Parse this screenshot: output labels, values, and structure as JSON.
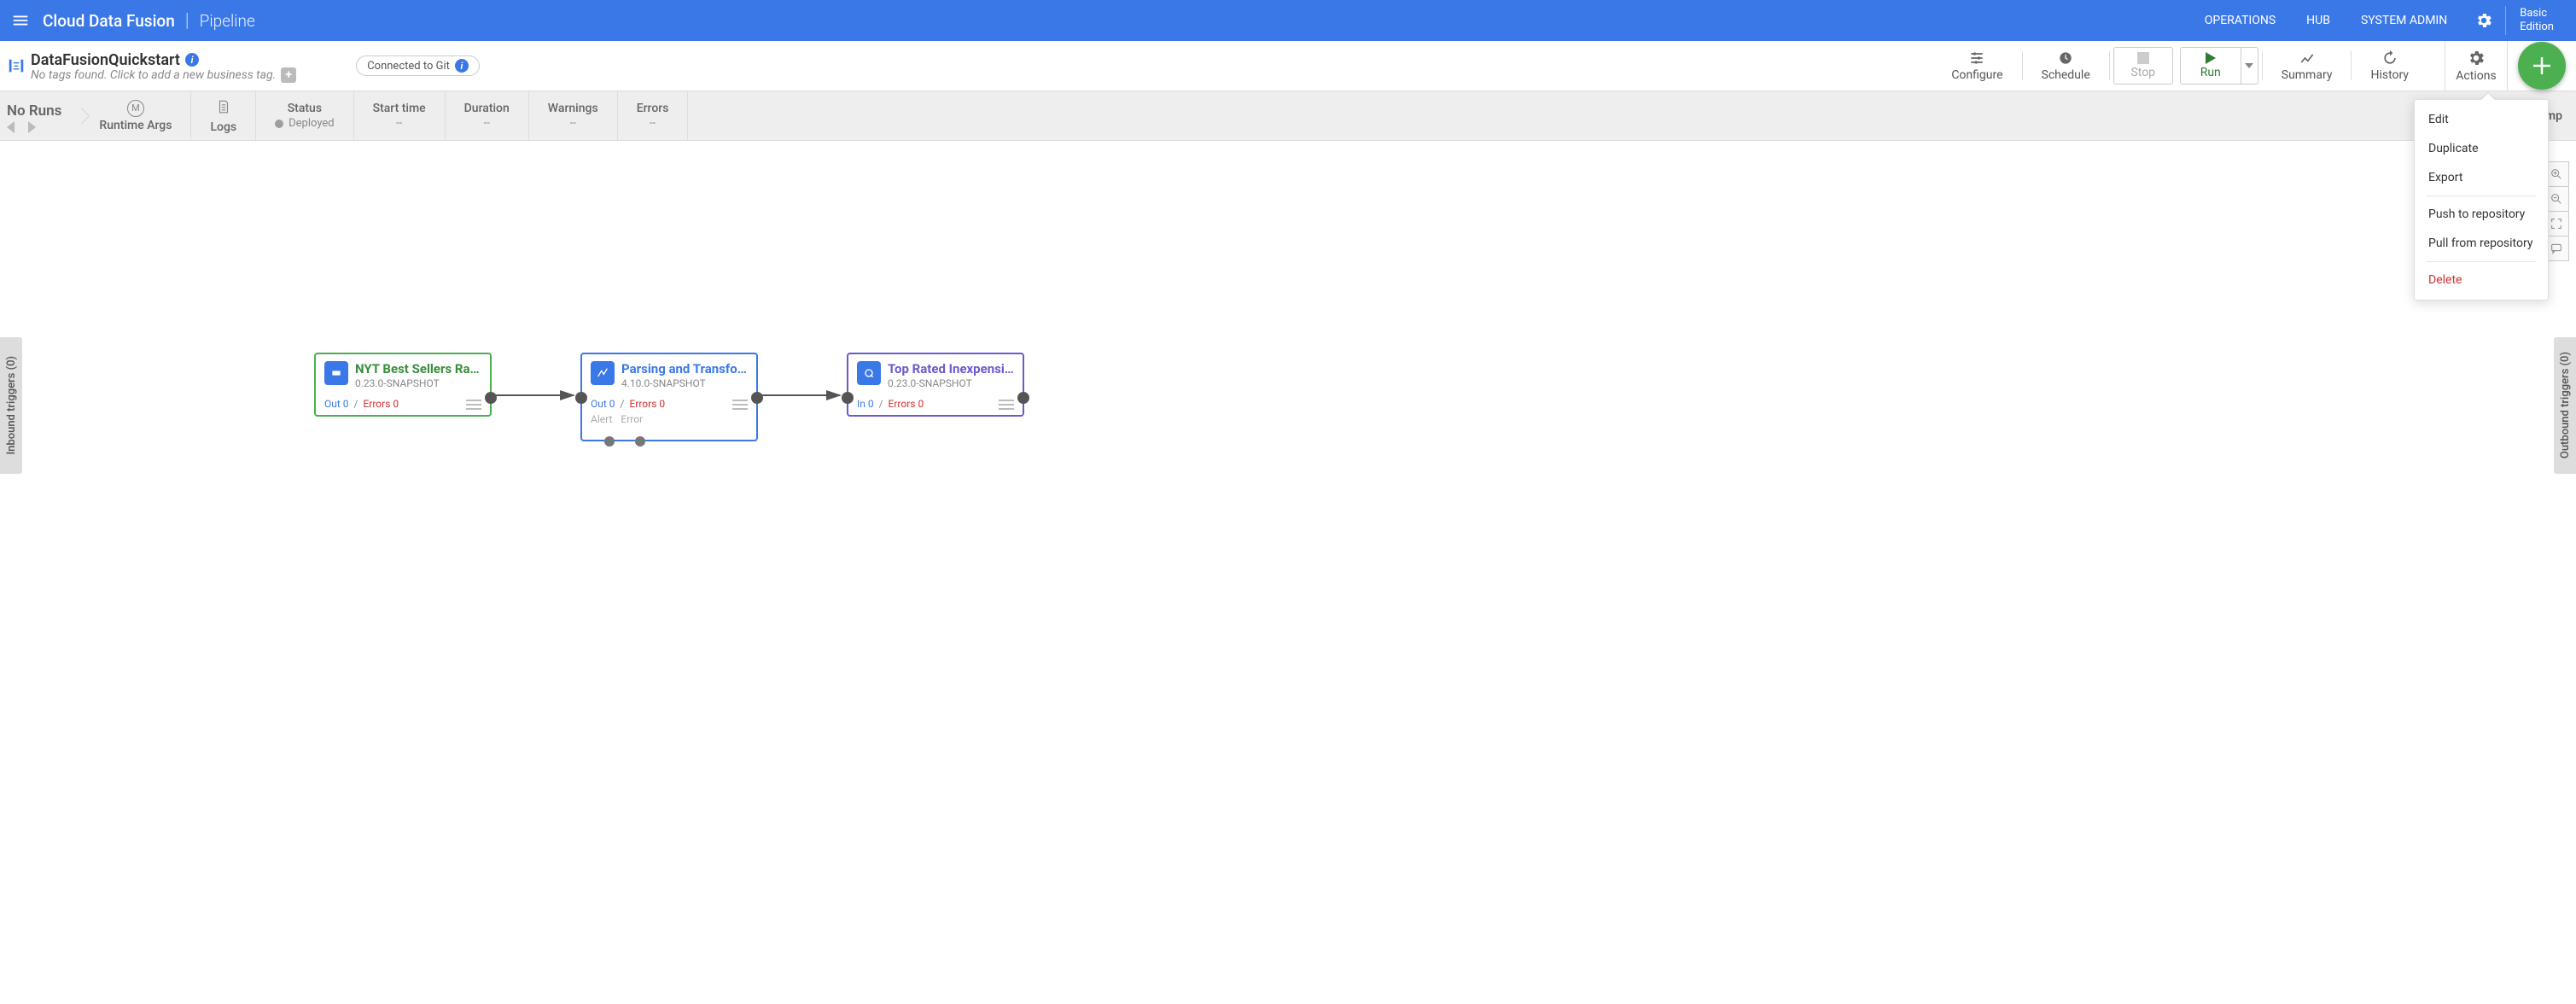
{
  "header": {
    "brand": "Cloud Data Fusion",
    "section": "Pipeline",
    "nav": {
      "operations": "OPERATIONS",
      "hub": "HUB",
      "systemAdmin": "SYSTEM ADMIN"
    },
    "edition_line1": "Basic",
    "edition_line2": "Edition"
  },
  "pipeline": {
    "name": "DataFusionQuickstart",
    "tagsPlaceholder": "No tags found. Click to add a new business tag.",
    "gitStatus": "Connected to Git"
  },
  "toolbar": {
    "configure": "Configure",
    "schedule": "Schedule",
    "stop": "Stop",
    "run": "Run",
    "summary": "Summary",
    "history": "History",
    "actions": "Actions"
  },
  "status": {
    "noRuns": "No Runs",
    "runtimeArgs": "Runtime Args",
    "logs": "Logs",
    "statusLabel": "Status",
    "statusValue": "Deployed",
    "startTime": {
      "label": "Start time",
      "value": "--"
    },
    "duration": {
      "label": "Duration",
      "value": "--"
    },
    "warnings": {
      "label": "Warnings",
      "value": "--"
    },
    "errors": {
      "label": "Errors",
      "value": "--"
    },
    "computeLabel": "Comp"
  },
  "triggers": {
    "inbound": "Inbound triggers (0)",
    "outbound": "Outbound triggers (0)"
  },
  "nodes": {
    "n1": {
      "title": "NYT Best Sellers Ra…",
      "version": "0.23.0-SNAPSHOT",
      "out": "Out 0",
      "err": "Errors 0"
    },
    "n2": {
      "title": "Parsing and Transfo…",
      "version": "4.10.0-SNAPSHOT",
      "out": "Out 0",
      "err": "Errors 0",
      "alert": "Alert",
      "error": "Error"
    },
    "n3": {
      "title": "Top Rated Inexpensi…",
      "version": "0.23.0-SNAPSHOT",
      "in": "In 0",
      "err": "Errors 0"
    }
  },
  "actionsMenu": {
    "edit": "Edit",
    "duplicate": "Duplicate",
    "export": "Export",
    "push": "Push to repository",
    "pull": "Pull from repository",
    "delete": "Delete"
  }
}
